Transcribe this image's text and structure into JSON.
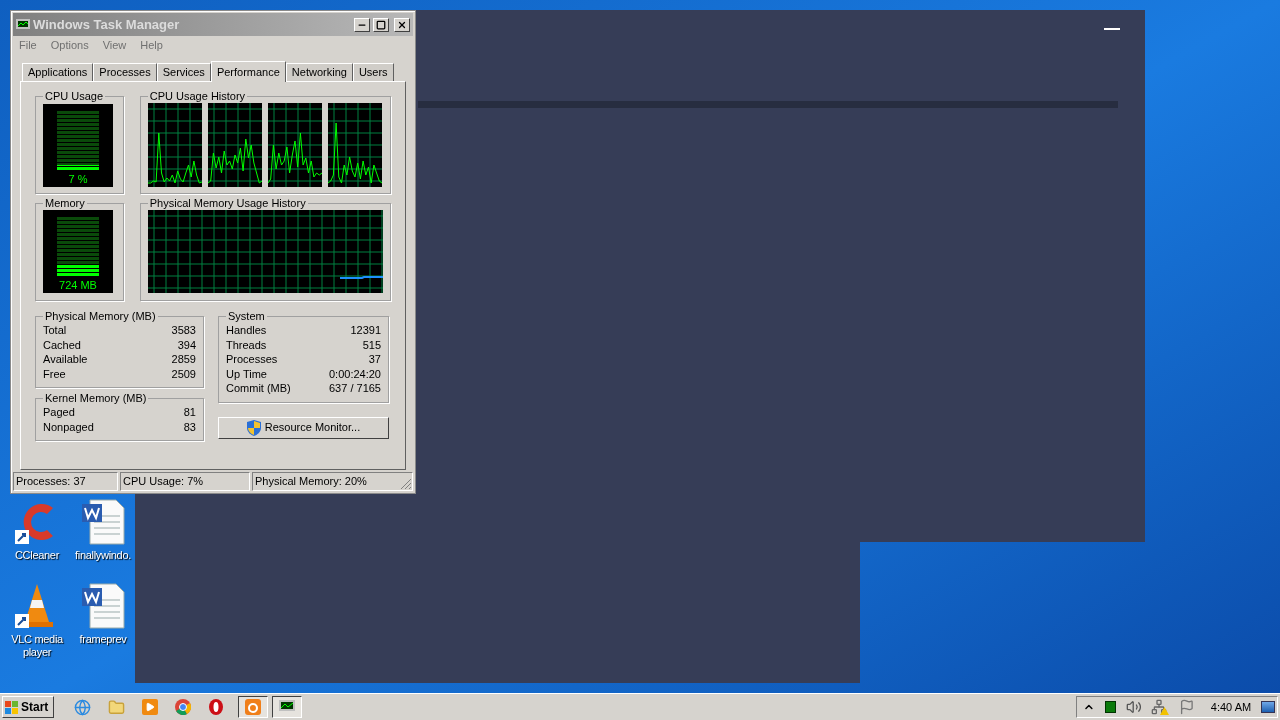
{
  "task_manager": {
    "title": "Windows Task Manager",
    "menu": [
      "File",
      "Options",
      "View",
      "Help"
    ],
    "tabs": [
      {
        "label": "Applications",
        "selected": false
      },
      {
        "label": "Processes",
        "selected": false
      },
      {
        "label": "Services",
        "selected": false
      },
      {
        "label": "Performance",
        "selected": true
      },
      {
        "label": "Networking",
        "selected": false
      },
      {
        "label": "Users",
        "selected": false
      }
    ],
    "cpu_usage": {
      "title": "CPU Usage",
      "level": 0.07,
      "reading": "7 %"
    },
    "cpu_history": {
      "title": "CPU Usage History"
    },
    "memory": {
      "title": "Memory",
      "level": 0.2,
      "reading": "724 MB"
    },
    "memory_history": {
      "title": "Physical Memory Usage History"
    },
    "physical_memory": {
      "title": "Physical Memory (MB)",
      "rows": [
        {
          "label": "Total",
          "value": "3583"
        },
        {
          "label": "Cached",
          "value": "394"
        },
        {
          "label": "Available",
          "value": "2859"
        },
        {
          "label": "Free",
          "value": "2509"
        }
      ]
    },
    "kernel_memory": {
      "title": "Kernel Memory (MB)",
      "rows": [
        {
          "label": "Paged",
          "value": "81"
        },
        {
          "label": "Nonpaged",
          "value": "83"
        }
      ]
    },
    "system": {
      "title": "System",
      "rows": [
        {
          "label": "Handles",
          "value": "12391"
        },
        {
          "label": "Threads",
          "value": "515"
        },
        {
          "label": "Processes",
          "value": "37"
        },
        {
          "label": "Up Time",
          "value": "0:00:24:20"
        },
        {
          "label": "Commit (MB)",
          "value": "637 / 7165"
        }
      ]
    },
    "resource_monitor_button": "Resource Monitor...",
    "status_bar": [
      "Processes: 37",
      "CPU Usage: 7%",
      "Physical Memory: 20%"
    ]
  },
  "desktop_icons": [
    {
      "label": "CCleaner",
      "kind": "ccleaner"
    },
    {
      "label": "finallywindo.",
      "kind": "document"
    },
    {
      "label": "VLC media player",
      "kind": "vlc"
    },
    {
      "label": "frameprev",
      "kind": "document"
    }
  ],
  "taskbar": {
    "start": "Start",
    "clock": "4:40 AM"
  }
}
